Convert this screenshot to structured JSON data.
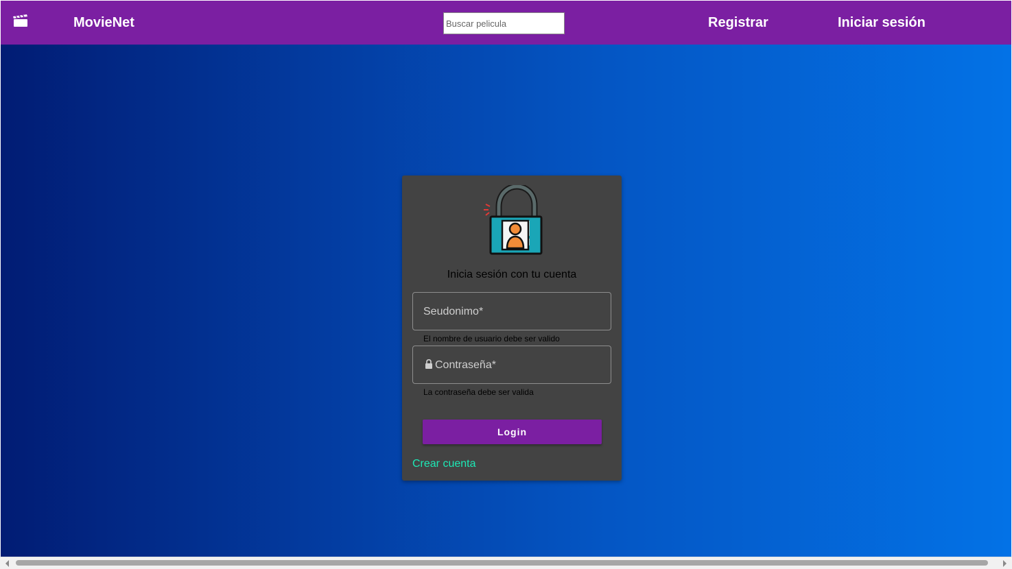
{
  "navbar": {
    "logo_icon": "movie-clapperboard-icon",
    "brand": "MovieNet",
    "search_placeholder": "Buscar pelicula",
    "register_label": "Registrar",
    "login_label": "Iniciar sesión",
    "background_color": "#7b1fa2"
  },
  "login_card": {
    "illustration": "unlocked-padlock-user-icon",
    "title": "Inicia sesión con tu cuenta",
    "username_field": {
      "label": "Seudonimo*",
      "hint": "El nombre de usuario debe ser valido"
    },
    "password_field": {
      "icon": "lock-icon",
      "label": "Contraseña*",
      "hint": "La contraseña debe ser valida"
    },
    "login_button": "Login",
    "create_account_link": "Crear cuenta",
    "accent_color": "#1de9b6"
  }
}
